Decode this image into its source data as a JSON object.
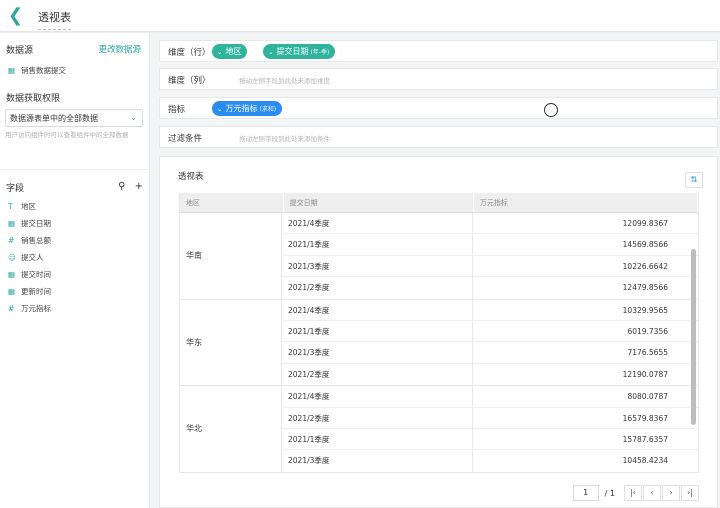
{
  "header": {
    "title": "透视表"
  },
  "sidebar": {
    "datasource_title": "数据源",
    "change_link": "更改数据源",
    "datasource_name": "销售数据提交",
    "permission_title": "数据获取权限",
    "permission_value": "数据源表单中的全部数据",
    "permission_hint": "用户访问组件时可以查看组件中的全部数据",
    "fields_title": "字段",
    "fields": [
      {
        "label": "地区",
        "icon": "text-icon"
      },
      {
        "label": "提交日期",
        "icon": "calendar-icon"
      },
      {
        "label": "销售总额",
        "icon": "number-icon"
      },
      {
        "label": "提交人",
        "icon": "user-icon"
      },
      {
        "label": "提交时间",
        "icon": "calendar-icon"
      },
      {
        "label": "更新时间",
        "icon": "calendar-icon"
      },
      {
        "label": "万元指标",
        "icon": "number-icon"
      }
    ]
  },
  "config": {
    "rows_label": "维度（行）",
    "row_pills": [
      {
        "label": "地区",
        "sub": ""
      },
      {
        "label": "提交日期",
        "sub": "(年-季)"
      }
    ],
    "cols_label": "维度（列）",
    "cols_hint": "拖动左侧字段到此处来添加维度",
    "metric_label": "指标",
    "metric_pill": {
      "label": "万元指标",
      "sub": "(求和)"
    },
    "filter_label": "过滤条件",
    "filter_hint": "拖动左侧字段到此处来添加条件"
  },
  "panel": {
    "title": "透视表",
    "columns": [
      "地区",
      "提交日期",
      "万元指标"
    ],
    "groups": [
      {
        "region": "华南",
        "rows": [
          {
            "date": "2021/4季度",
            "value": "12099.8367"
          },
          {
            "date": "2021/1季度",
            "value": "14569.8566"
          },
          {
            "date": "2021/3季度",
            "value": "10226.6642"
          },
          {
            "date": "2021/2季度",
            "value": "12479.8566"
          }
        ]
      },
      {
        "region": "华东",
        "rows": [
          {
            "date": "2021/4季度",
            "value": "10329.9565"
          },
          {
            "date": "2021/1季度",
            "value": "6019.7356"
          },
          {
            "date": "2021/3季度",
            "value": "7176.5655"
          },
          {
            "date": "2021/2季度",
            "value": "12190.0787"
          }
        ]
      },
      {
        "region": "华北",
        "rows": [
          {
            "date": "2021/4季度",
            "value": "8080.0787"
          },
          {
            "date": "2021/2季度",
            "value": "16579.8367"
          },
          {
            "date": "2021/1季度",
            "value": "15787.6357"
          },
          {
            "date": "2021/3季度",
            "value": "10458.4234"
          }
        ]
      }
    ],
    "pagination": {
      "current": "1",
      "total": "/ 1"
    }
  }
}
